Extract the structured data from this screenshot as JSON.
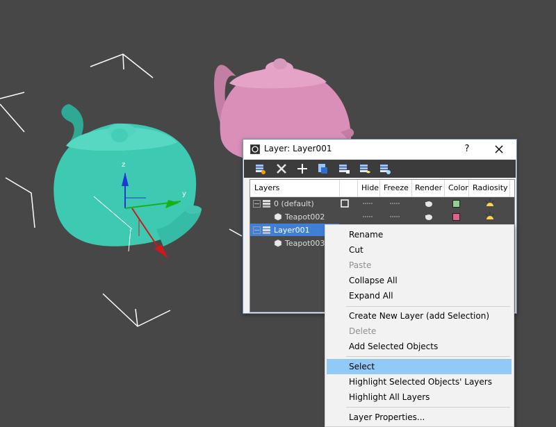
{
  "dialog": {
    "title": "Layer: Layer001",
    "help_label": "?",
    "toolbar": [
      "create-layer-icon",
      "delete-layer-icon",
      "add-to-layer-icon",
      "select-objects-icon",
      "highlight-layer-icon",
      "hide-all-icon",
      "freeze-all-icon"
    ]
  },
  "columns": [
    "Layers",
    "Hide",
    "Freeze",
    "Render",
    "Color",
    "Radiosity"
  ],
  "layers": [
    {
      "name": "0 (default)",
      "color": "#90d090"
    },
    {
      "name": "Teapot002",
      "color": "#e0608f"
    },
    {
      "name": "Layer001"
    },
    {
      "name": "Teapot003"
    }
  ],
  "context_menu": [
    {
      "label": "Rename"
    },
    {
      "label": "Cut"
    },
    {
      "label": "Paste",
      "disabled": true
    },
    {
      "label": "Collapse All"
    },
    {
      "label": "Expand All"
    },
    {
      "label": "Create New Layer (add Selection)"
    },
    {
      "label": "Delete",
      "disabled": true
    },
    {
      "label": "Add Selected Objects"
    },
    {
      "label": "Select",
      "highlighted": true
    },
    {
      "label": "Highlight Selected Objects' Layers"
    },
    {
      "label": "Highlight All Layers"
    },
    {
      "label": "Layer Properties..."
    }
  ],
  "colors": {
    "teapot_teal": "#3ec9b2",
    "teapot_pink": "#d98fb8",
    "viewport_bg": "#474747",
    "selection": "#3f7fd8",
    "menu_highlight": "#91c9f7"
  }
}
